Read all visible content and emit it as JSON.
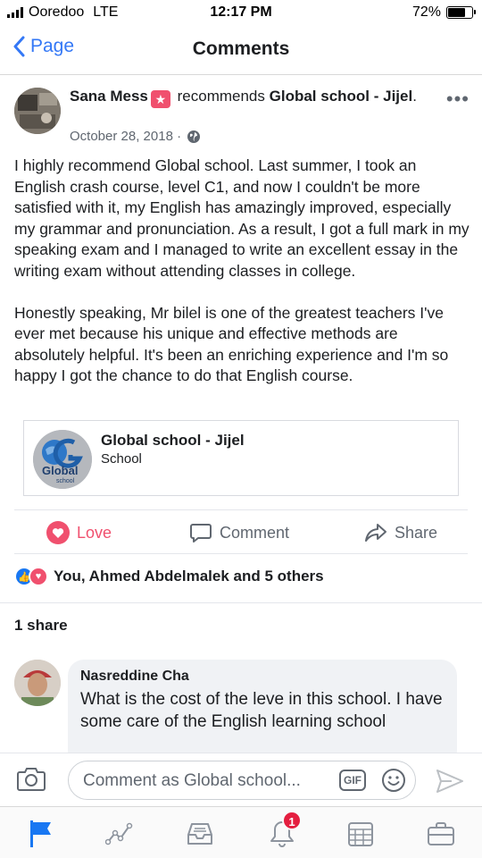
{
  "status_bar": {
    "carrier": "Ooredoo",
    "network": "LTE",
    "time": "12:17 PM",
    "battery": "72%",
    "battery_level": 0.72
  },
  "nav": {
    "back_label": "Page",
    "title": "Comments"
  },
  "post": {
    "author": "Sana Mess",
    "action": "recommends",
    "page_name": "Global school - Jijel",
    "date": "October 28, 2018 ·",
    "body_paragraphs": [
      "I highly recommend Global school. Last summer, I took an English crash course, level C1, and now I couldn't be more satisfied with it, my English has amazingly improved, especially my grammar and pronunciation. As a result, I got a full mark in my speaking exam and I managed to write an excellent essay in the writing exam without attending classes in college.",
      "Honestly speaking, Mr bilel is one of the greatest teachers I've ever met because his unique and effective methods are absolutely helpful. It's been an enriching experience and I'm so happy I got the chance to do that English course."
    ],
    "card": {
      "title": "Global school - Jijel",
      "subtitle": "School",
      "logo_text": "Global",
      "logo_subtext": "school"
    }
  },
  "actions": {
    "love": "Love",
    "comment": "Comment",
    "share": "Share"
  },
  "reactions_summary": "You, Ahmed Abdelmalek and 5 others",
  "shares_count": "1 share",
  "comment": {
    "author": "Nasreddine Cha",
    "text": "What is the cost of the leve in this school. I have some care of the English learning school"
  },
  "composer": {
    "placeholder": "Comment as Global school...",
    "gif_label": "GIF"
  },
  "tabbar": {
    "notifications_count": "1"
  },
  "colors": {
    "ios_blue": "#3478f6",
    "love_red": "#f0506e",
    "like_blue": "#1877f2",
    "secondary_text": "#606770"
  }
}
